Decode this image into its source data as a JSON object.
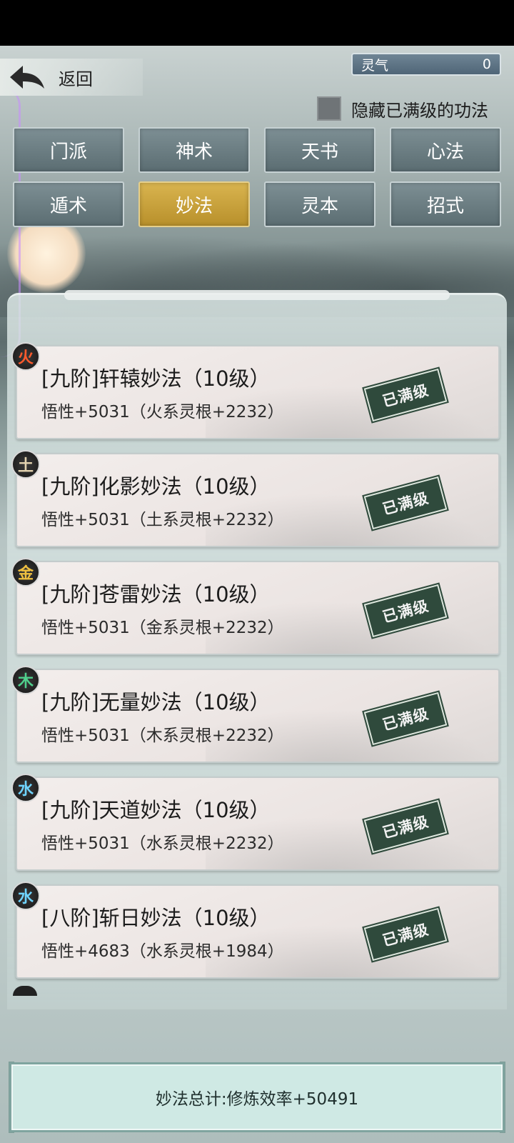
{
  "header": {
    "back_label": "返回",
    "currency_label": "灵气",
    "currency_value": "0",
    "hide_maxed_label": "隐藏已满级的功法",
    "hide_maxed_checked": false
  },
  "tabs": [
    {
      "label": "门派",
      "active": false
    },
    {
      "label": "神术",
      "active": false
    },
    {
      "label": "天书",
      "active": false
    },
    {
      "label": "心法",
      "active": false
    },
    {
      "label": "遁术",
      "active": false
    },
    {
      "label": "妙法",
      "active": true
    },
    {
      "label": "灵本",
      "active": false
    },
    {
      "label": "招式",
      "active": false
    }
  ],
  "colors": {
    "active_tab": "#d9b44f",
    "tab": "#6b7d82",
    "stamp": "#2f4a3c",
    "element_fire": "#ff5a2c",
    "element_earth": "#e3d3b0",
    "element_metal": "#f0c040",
    "element_wood": "#4fd08c",
    "element_water": "#6fd4ff"
  },
  "skills": [
    {
      "element": "火",
      "element_color": "#ff5a2c",
      "title": "[九阶]轩辕妙法（10级）",
      "effect": "悟性+5031（火系灵根+2232）",
      "status": "已满级"
    },
    {
      "element": "土",
      "element_color": "#e3d3b0",
      "title": "[九阶]化影妙法（10级）",
      "effect": "悟性+5031（土系灵根+2232）",
      "status": "已满级"
    },
    {
      "element": "金",
      "element_color": "#f0c040",
      "title": "[九阶]苍雷妙法（10级）",
      "effect": "悟性+5031（金系灵根+2232）",
      "status": "已满级"
    },
    {
      "element": "木",
      "element_color": "#4fd08c",
      "title": "[九阶]无量妙法（10级）",
      "effect": "悟性+5031（木系灵根+2232）",
      "status": "已满级"
    },
    {
      "element": "水",
      "element_color": "#6fd4ff",
      "title": "[九阶]天道妙法（10级）",
      "effect": "悟性+5031（水系灵根+2232）",
      "status": "已满级"
    },
    {
      "element": "水",
      "element_color": "#6fd4ff",
      "title": "[八阶]斩日妙法（10级）",
      "effect": "悟性+4683（水系灵根+1984）",
      "status": "已满级"
    }
  ],
  "footer": {
    "summary": "妙法总计:修炼效率+50491"
  }
}
